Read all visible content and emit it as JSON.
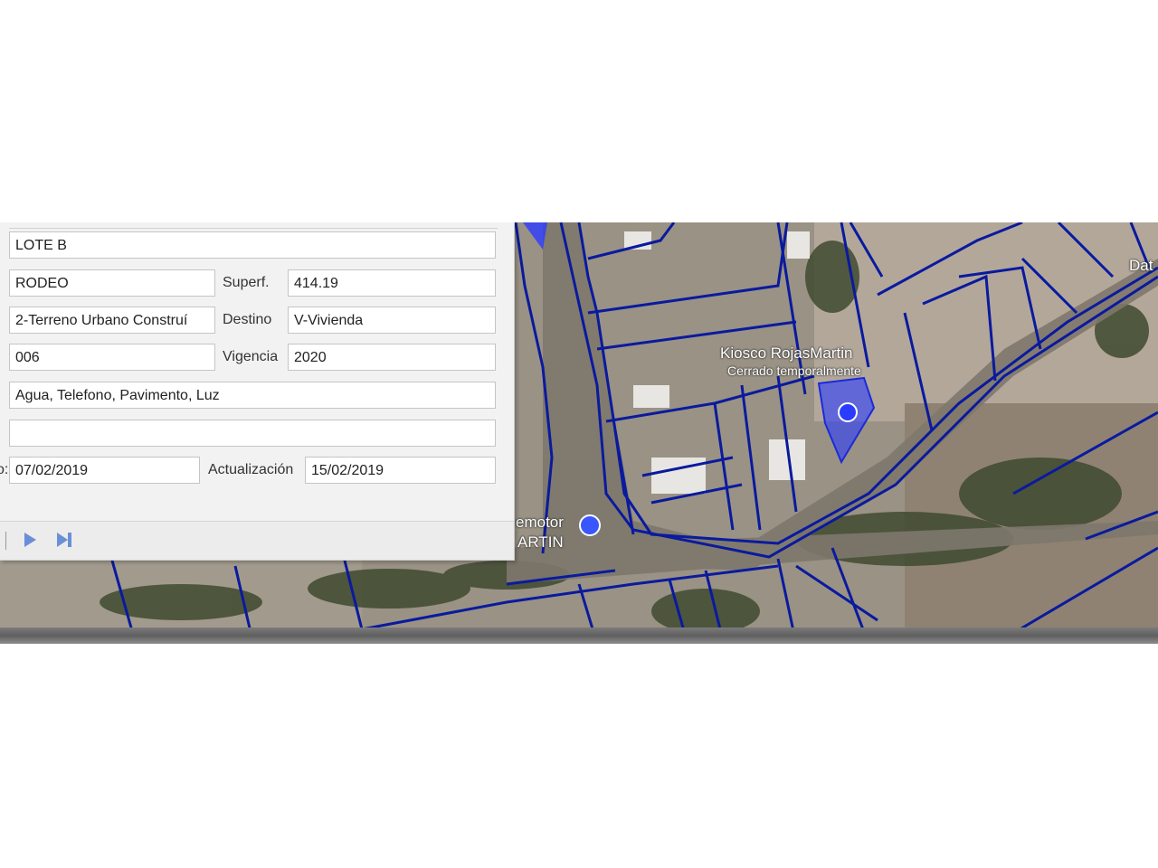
{
  "form": {
    "lote": "LOTE B",
    "localidad": "RODEO",
    "superficie_label": "Superf.",
    "superficie": "414.19",
    "tipo": "2-Terreno Urbano Construí",
    "destino_label": "Destino",
    "destino": "V-Vivienda",
    "codigo": "006",
    "vigencia_label": "Vigencia",
    "vigencia": "2020",
    "servicios": "Agua, Telefono, Pavimento, Luz",
    "observaciones": "",
    "fecha_label_partial": "o:",
    "fecha": "07/02/2019",
    "actualizacion_label": "Actualización",
    "actualizacion": "15/02/2019"
  },
  "map": {
    "place_name": "Kiosco RojasMartin",
    "place_status": "Cerrado temporalmente",
    "partial_label_1": "emotor",
    "partial_label_2": "ARTIN",
    "partial_label_3": "Dat",
    "parcel_line_color": "#0a1a9e",
    "highlight_color": "#2a3cff"
  }
}
